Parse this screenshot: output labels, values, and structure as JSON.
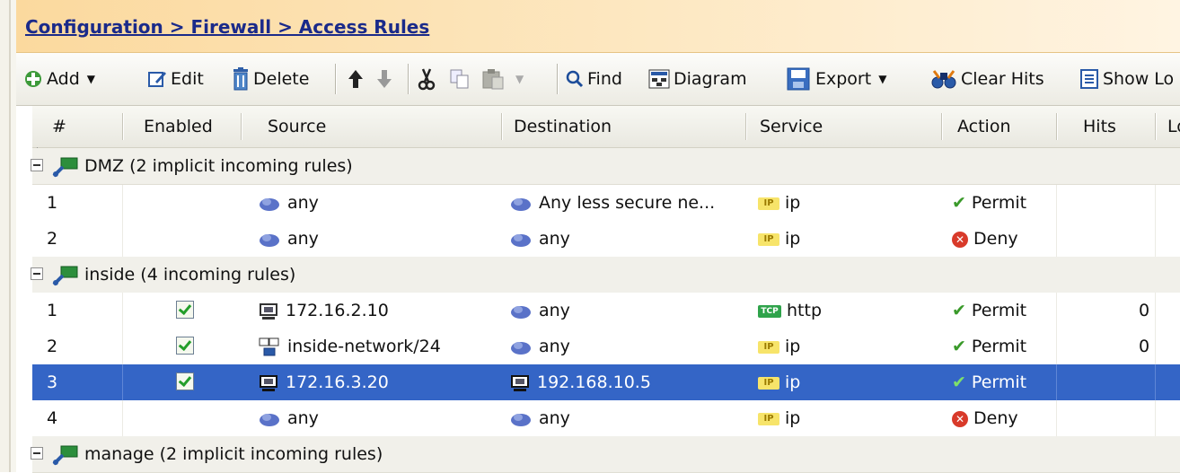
{
  "breadcrumb": "Configuration > Firewall > Access Rules",
  "toolbar": {
    "add": "Add",
    "edit": "Edit",
    "delete": "Delete",
    "find": "Find",
    "diagram": "Diagram",
    "export": "Export",
    "clear_hits": "Clear Hits",
    "show_log": "Show Lo"
  },
  "columns": {
    "num": "#",
    "enabled": "Enabled",
    "source": "Source",
    "destination": "Destination",
    "service": "Service",
    "action": "Action",
    "hits": "Hits",
    "log": "Lo"
  },
  "groups": [
    {
      "label": "DMZ (2 implicit incoming rules)",
      "rules": [
        {
          "num": "1",
          "source": "any",
          "destination": "Any less secure ne...",
          "service": "ip",
          "action": "Permit",
          "hits": ""
        },
        {
          "num": "2",
          "source": "any",
          "destination": "any",
          "service": "ip",
          "action": "Deny",
          "hits": ""
        }
      ]
    },
    {
      "label": "inside (4 incoming rules)",
      "rules": [
        {
          "num": "1",
          "source": "172.16.2.10",
          "destination": "any",
          "service": "http",
          "action": "Permit",
          "hits": "0"
        },
        {
          "num": "2",
          "source": "inside-network/24",
          "destination": "any",
          "service": "ip",
          "action": "Permit",
          "hits": "0"
        },
        {
          "num": "3",
          "source": "172.16.3.20",
          "destination": "192.168.10.5",
          "service": "ip",
          "action": "Permit",
          "hits": ""
        },
        {
          "num": "4",
          "source": "any",
          "destination": "any",
          "service": "ip",
          "action": "Deny",
          "hits": ""
        }
      ]
    },
    {
      "label": "manage (2 implicit incoming rules)",
      "rules": []
    }
  ],
  "colors": {
    "selection": "#3465c6",
    "breadcrumb_link": "#1a2a8a",
    "permit_check": "#3a9a2a",
    "deny_red": "#d83a2a"
  }
}
